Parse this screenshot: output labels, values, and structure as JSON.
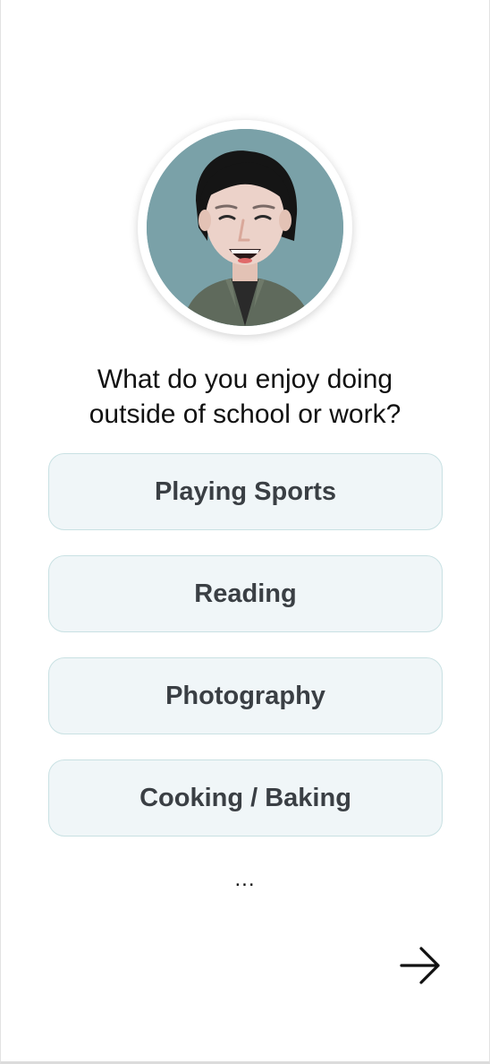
{
  "question": {
    "line1": "What do you enjoy doing",
    "line2": "outside of school or work?"
  },
  "options": [
    {
      "label": "Playing Sports"
    },
    {
      "label": "Reading"
    },
    {
      "label": "Photography"
    },
    {
      "label": "Cooking / Baking"
    }
  ],
  "more_indicator": "...",
  "next_icon": "arrow-right-icon",
  "colors": {
    "avatar_background": "#7aa1a8",
    "option_background": "#f0f6f8",
    "option_border": "#c9e1e3",
    "option_text": "#3a3f44"
  }
}
